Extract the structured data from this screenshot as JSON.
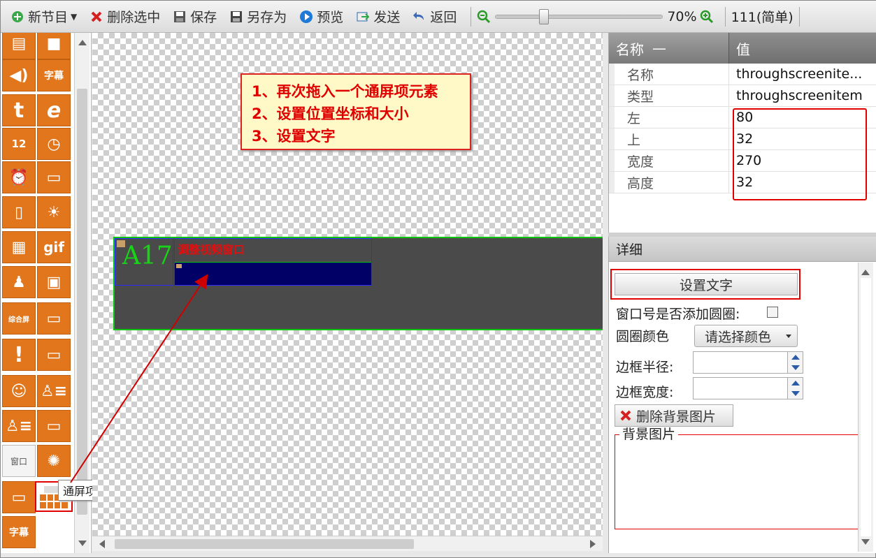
{
  "toolbar": {
    "new_program": "新节目",
    "delete_selected": "删除选中",
    "save": "保存",
    "save_as": "另存为",
    "preview": "预览",
    "send": "发送",
    "back": "返回",
    "zoom_value": "70%",
    "program_name": "111(简单)"
  },
  "toolbox": {
    "tooltip": "通屏项",
    "window_label": "窗口",
    "subtitle_label": "字幕",
    "composite_label": "综合屏"
  },
  "canvas": {
    "window_item_label": "A17",
    "through_item_text": "调整视频窗口",
    "callout": {
      "line1": "1、再次拖入一个通屏项元素",
      "line2": "2、设置位置坐标和大小",
      "line3": "3、设置文字"
    }
  },
  "properties": {
    "header_name": "名称",
    "header_collapse": "—",
    "header_value": "值",
    "rows": [
      {
        "key": "名称",
        "value": "throughscreenite..."
      },
      {
        "key": "类型",
        "value": "throughscreenitem"
      },
      {
        "key": "左",
        "value": "80"
      },
      {
        "key": "上",
        "value": "32"
      },
      {
        "key": "宽度",
        "value": "270"
      },
      {
        "key": "高度",
        "value": "32"
      }
    ]
  },
  "details": {
    "title": "详细",
    "set_text_button": "设置文字",
    "circle_label": "窗口号是否添加圆圈:",
    "circle_color_label": "圆圈颜色",
    "color_dropdown": "请选择颜色",
    "border_radius_label": "边框半径:",
    "border_width_label": "边框宽度:",
    "delete_bg_button": "删除背景图片",
    "bg_image_label": "背景图片"
  },
  "colors": {
    "accent_orange": "#e2761d",
    "highlight_red": "#e00000",
    "screen_green": "#12c412"
  }
}
